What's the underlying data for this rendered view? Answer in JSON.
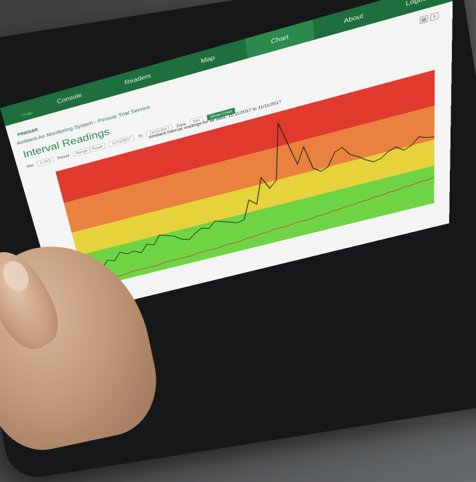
{
  "nav": {
    "items": [
      "Console",
      "Readers",
      "Map",
      "Chart",
      "About",
      "Logout"
    ],
    "active": "Chart"
  },
  "brand": {
    "logo_text": "PINSSAR"
  },
  "header": {
    "system_title": "Ambient Air Monitoring System - Pinssar Trial Service",
    "page_title": "Interval Readings"
  },
  "filters": {
    "site_label": "Site",
    "site_value": "2-4SS",
    "period_label": "Period",
    "range_label": "Range 1 Reset",
    "from_value": "11/11/2017",
    "to_label": "To",
    "to_value": "11/11/2017",
    "zone_label": "Zone",
    "zone_value": "Site",
    "show_button": "Show Chart"
  },
  "chart_title": "Ambient interval readings for all sites, 11/11/2017 to 11/11/2017",
  "colors": {
    "brand_green": "#1f6e3d",
    "band_red": "#e03a2f",
    "band_orange": "#e9823f",
    "band_yellow": "#e6d23a",
    "band_green": "#6fd445"
  },
  "chart_data": {
    "type": "line",
    "series": [
      {
        "values": [
          10,
          12,
          15,
          14,
          20,
          18,
          24,
          21,
          22,
          19,
          25,
          23,
          30,
          28,
          26,
          22,
          20,
          24,
          27,
          25,
          30,
          28,
          26,
          24,
          25,
          40,
          35,
          55,
          45,
          50,
          92,
          75,
          58,
          70,
          52,
          48,
          50,
          60,
          62,
          55,
          52,
          48,
          45,
          46,
          50,
          52,
          48,
          50,
          55,
          53,
          52
        ]
      },
      {
        "values": [
          3,
          3,
          3,
          4,
          4,
          4,
          4,
          5,
          5,
          5,
          5,
          5,
          6,
          6,
          6,
          6,
          6,
          7,
          7,
          7,
          7,
          8,
          8,
          8,
          9,
          9,
          10,
          10,
          11,
          11,
          11,
          12,
          12,
          12,
          13,
          13,
          14,
          14,
          15,
          15,
          16,
          16,
          17,
          17,
          18,
          18,
          19,
          19,
          20,
          20,
          21
        ]
      }
    ],
    "bands": [
      {
        "from": 0,
        "to": 30,
        "color": "band_green"
      },
      {
        "from": 30,
        "to": 50,
        "color": "band_yellow"
      },
      {
        "from": 50,
        "to": 75,
        "color": "band_orange"
      },
      {
        "from": 75,
        "to": 100,
        "color": "band_red"
      }
    ],
    "ylim": [
      0,
      100
    ]
  }
}
